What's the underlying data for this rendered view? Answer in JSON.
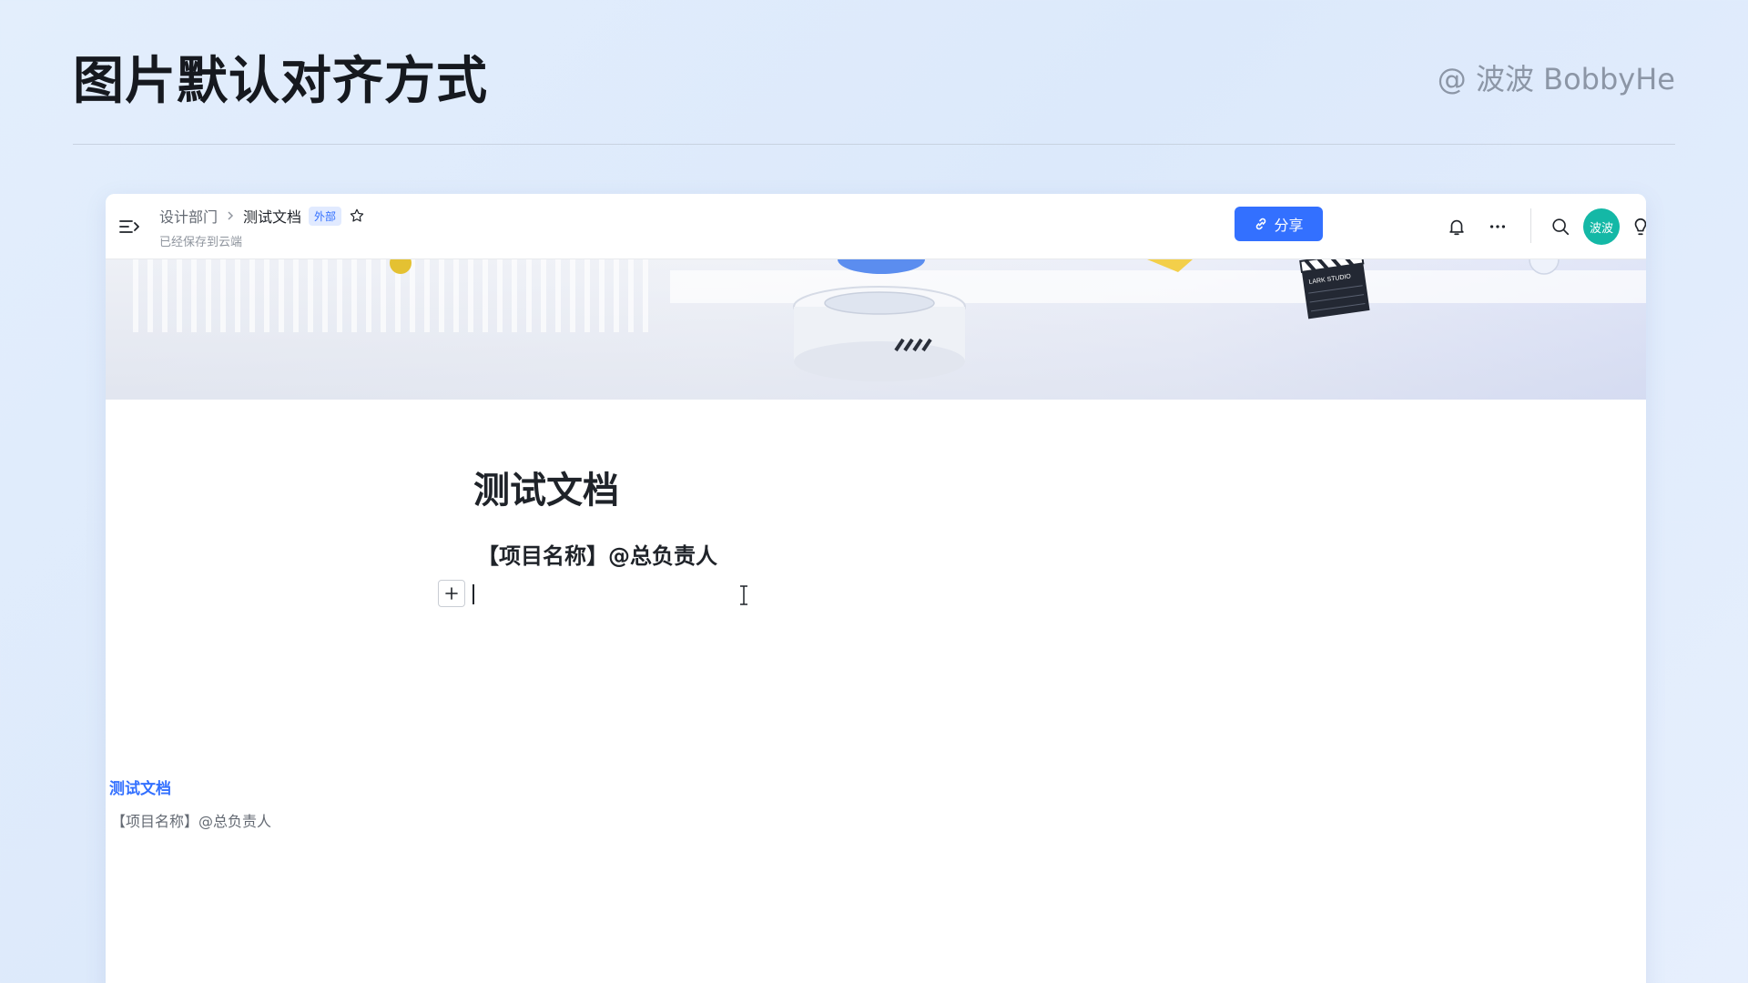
{
  "slide": {
    "title": "图片默认对齐方式",
    "credit": "@ 波波 BobbyHe"
  },
  "topbar": {
    "breadcrumb_parent": "设计部门",
    "breadcrumb_current": "测试文档",
    "badge": "外部",
    "save_status": "已经保存到云端",
    "share_label": "分享",
    "avatar_text": "波波"
  },
  "banner": {
    "clapper_text": "LARK STUDIO"
  },
  "document": {
    "title": "测试文档",
    "line1": "【项目名称】@总负责人"
  },
  "preview": {
    "title": "测试文档",
    "line1": "【项目名称】@总负责人"
  },
  "icons": [
    "menu-icon",
    "chevron-right-icon",
    "star-icon",
    "link-icon",
    "bell-icon",
    "more-icon",
    "search-icon",
    "plus-icon",
    "lightbulb-icon",
    "add-block-icon",
    "text-cursor-icon"
  ],
  "colors": {
    "accent": "#3370ff",
    "avatar": "#14b8a6",
    "badge_bg": "#e1eaff"
  }
}
